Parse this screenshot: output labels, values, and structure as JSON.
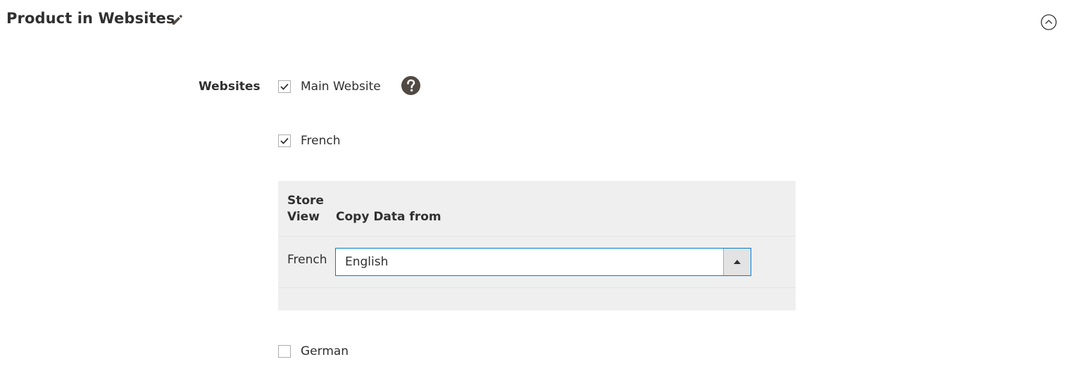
{
  "section": {
    "title": "Product in Websites",
    "edit_icon": "pencil-icon",
    "collapse_icon": "chevron-up-circle-icon"
  },
  "websites_field": {
    "label": "Websites",
    "help_icon": "question-circle-icon",
    "options": [
      {
        "label": "Main Website",
        "checked": true
      },
      {
        "label": "French",
        "checked": true
      },
      {
        "label": "German",
        "checked": false
      }
    ]
  },
  "store_view_table": {
    "headers": {
      "store_view": "Store View",
      "copy_data_from": "Copy Data from"
    },
    "rows": [
      {
        "store_view": "French",
        "copy_from_selected": "English"
      }
    ]
  },
  "colors": {
    "select_border": "#007bdb",
    "table_bg": "#efefef",
    "text": "#303030"
  }
}
